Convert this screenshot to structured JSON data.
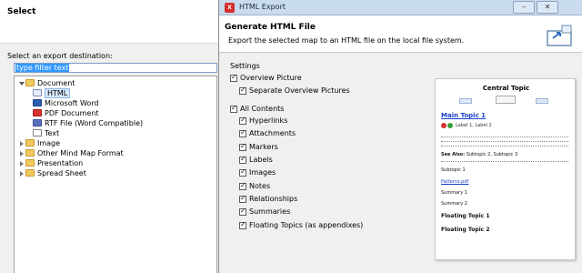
{
  "left_dialog": {
    "title": "Select",
    "prompt": "Select an export destination:",
    "filter_text": "type filter text",
    "tree": [
      {
        "label": "Document",
        "icon": "folder-icon"
      },
      {
        "label": "HTML",
        "icon": "html-file-icon"
      },
      {
        "label": "Microsoft Word",
        "icon": "word-file-icon"
      },
      {
        "label": "PDF Document",
        "icon": "pdf-file-icon"
      },
      {
        "label": "RTF File (Word Compatible)",
        "icon": "rtf-file-icon"
      },
      {
        "label": "Text",
        "icon": "text-file-icon"
      },
      {
        "label": "Image",
        "icon": "folder-icon"
      },
      {
        "label": "Other Mind Map Format",
        "icon": "folder-icon"
      },
      {
        "label": "Presentation",
        "icon": "folder-icon"
      },
      {
        "label": "Spread Sheet",
        "icon": "folder-icon"
      }
    ]
  },
  "right_dialog": {
    "window_title": "HTML Export",
    "app_icon_text": "X",
    "min_label": "–",
    "close_label": "✕",
    "header_title": "Generate HTML File",
    "header_desc": "Export the selected map to an HTML file on the local file system.",
    "settings_label": "Settings",
    "options": [
      {
        "label": "Overview Picture",
        "checked": true
      },
      {
        "label": "Separate Overview Pictures",
        "checked": true
      },
      {
        "label": "All Contents",
        "checked": true
      },
      {
        "label": "Hyperlinks",
        "checked": true
      },
      {
        "label": "Attachments",
        "checked": true
      },
      {
        "label": "Markers",
        "checked": true
      },
      {
        "label": "Labels",
        "checked": true
      },
      {
        "label": "Images",
        "checked": true
      },
      {
        "label": "Notes",
        "checked": true
      },
      {
        "label": "Relationships",
        "checked": true
      },
      {
        "label": "Summaries",
        "checked": true
      },
      {
        "label": "Floating Topics (as appendixes)",
        "checked": true
      }
    ]
  },
  "preview": {
    "central_topic": "Central Topic",
    "main_topic": "Main Topic 1",
    "marker_labels": "Label 1, Label 2",
    "see_also_label": "See Also:",
    "see_also_value": "Subtopic 2, Subtopic 3",
    "subtopic1": "Subtopic 1",
    "attachment": "Patterns.pdf",
    "summary1": "Summary 1",
    "summary2": "Summary 2",
    "floating1": "Floating Topic 1",
    "floating2": "Floating Topic 2"
  }
}
